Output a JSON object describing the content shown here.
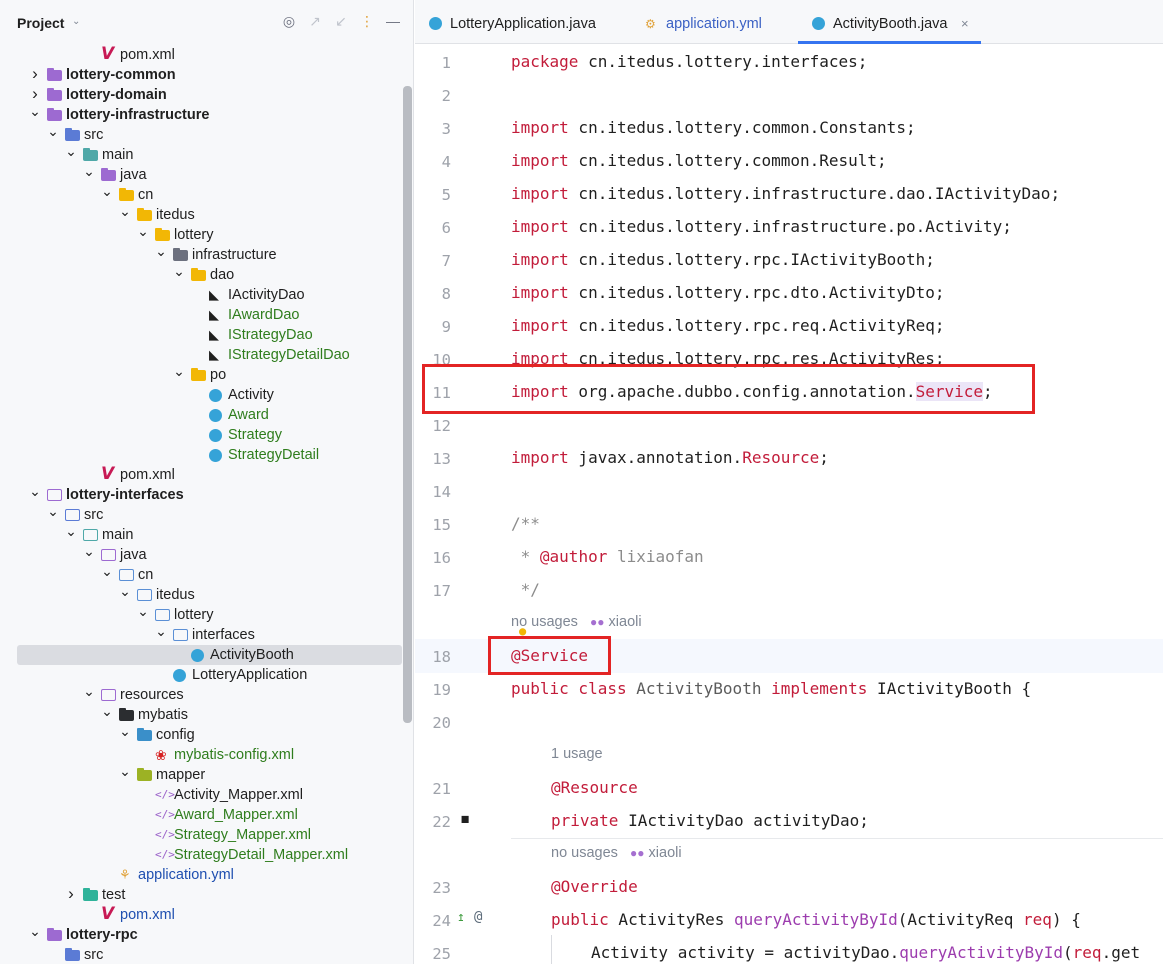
{
  "project_panel": {
    "title": "Project",
    "tree": [
      {
        "indent": 4,
        "label": "pom.xml",
        "icon": "maven-icon",
        "arrow": "",
        "style": ""
      },
      {
        "indent": 1,
        "label": "lottery-common",
        "icon": "module-folder-icon",
        "arrow": "right",
        "style": "bold"
      },
      {
        "indent": 1,
        "label": "lottery-domain",
        "icon": "module-folder-icon",
        "arrow": "right",
        "style": "bold"
      },
      {
        "indent": 1,
        "label": "lottery-infrastructure",
        "icon": "module-folder-icon",
        "arrow": "down",
        "style": "bold"
      },
      {
        "indent": 2,
        "label": "src",
        "icon": "src-folder-icon",
        "arrow": "down",
        "style": ""
      },
      {
        "indent": 3,
        "label": "main",
        "icon": "main-folder-icon",
        "arrow": "down",
        "style": ""
      },
      {
        "indent": 4,
        "label": "java",
        "icon": "java-folder-icon",
        "arrow": "down",
        "style": ""
      },
      {
        "indent": 5,
        "label": "cn",
        "icon": "package-folder-icon",
        "arrow": "down",
        "style": ""
      },
      {
        "indent": 6,
        "label": "itedus",
        "icon": "package-folder-icon",
        "arrow": "down",
        "style": ""
      },
      {
        "indent": 7,
        "label": "lottery",
        "icon": "package-folder-icon",
        "arrow": "down",
        "style": ""
      },
      {
        "indent": 8,
        "label": "infrastructure",
        "icon": "gray-package-icon",
        "arrow": "down",
        "style": ""
      },
      {
        "indent": 9,
        "label": "dao",
        "icon": "package-folder-icon",
        "arrow": "down",
        "style": ""
      },
      {
        "indent": 10,
        "label": "IActivityDao",
        "icon": "mybatis-bird-icon",
        "arrow": "",
        "style": ""
      },
      {
        "indent": 10,
        "label": "IAwardDao",
        "icon": "mybatis-bird-icon",
        "arrow": "",
        "style": "green"
      },
      {
        "indent": 10,
        "label": "IStrategyDao",
        "icon": "mybatis-bird-icon",
        "arrow": "",
        "style": "green"
      },
      {
        "indent": 10,
        "label": "IStrategyDetailDao",
        "icon": "mybatis-bird-icon",
        "arrow": "",
        "style": "green"
      },
      {
        "indent": 9,
        "label": "po",
        "icon": "package-folder-icon",
        "arrow": "down",
        "style": ""
      },
      {
        "indent": 10,
        "label": "Activity",
        "icon": "class-icon",
        "arrow": "",
        "style": ""
      },
      {
        "indent": 10,
        "label": "Award",
        "icon": "class-icon",
        "arrow": "",
        "style": "green"
      },
      {
        "indent": 10,
        "label": "Strategy",
        "icon": "class-icon",
        "arrow": "",
        "style": "green"
      },
      {
        "indent": 10,
        "label": "StrategyDetail",
        "icon": "class-icon",
        "arrow": "",
        "style": "green"
      },
      {
        "indent": 4,
        "label": "pom.xml",
        "icon": "maven-icon",
        "arrow": "",
        "style": ""
      },
      {
        "indent": 1,
        "label": "lottery-interfaces",
        "icon": "module-outline-icon",
        "arrow": "down",
        "style": "bold"
      },
      {
        "indent": 2,
        "label": "src",
        "icon": "src-outline-icon",
        "arrow": "down",
        "style": ""
      },
      {
        "indent": 3,
        "label": "main",
        "icon": "main-outline-icon",
        "arrow": "down",
        "style": ""
      },
      {
        "indent": 4,
        "label": "java",
        "icon": "java-outline-icon",
        "arrow": "down",
        "style": ""
      },
      {
        "indent": 5,
        "label": "cn",
        "icon": "package-outline-icon",
        "arrow": "down",
        "style": ""
      },
      {
        "indent": 6,
        "label": "itedus",
        "icon": "package-outline-icon",
        "arrow": "down",
        "style": ""
      },
      {
        "indent": 7,
        "label": "lottery",
        "icon": "package-outline-icon",
        "arrow": "down",
        "style": ""
      },
      {
        "indent": 8,
        "label": "interfaces",
        "icon": "package-outline-icon",
        "arrow": "down",
        "style": ""
      },
      {
        "indent": 9,
        "label": "ActivityBooth",
        "icon": "class-icon",
        "arrow": "",
        "style": "selected"
      },
      {
        "indent": 8,
        "label": "LotteryApplication",
        "icon": "class-icon",
        "arrow": "",
        "style": ""
      },
      {
        "indent": 4,
        "label": "resources",
        "icon": "resources-outline-icon",
        "arrow": "down",
        "style": ""
      },
      {
        "indent": 5,
        "label": "mybatis",
        "icon": "dark-folder-icon",
        "arrow": "down",
        "style": ""
      },
      {
        "indent": 6,
        "label": "config",
        "icon": "config-folder-icon",
        "arrow": "down",
        "style": ""
      },
      {
        "indent": 7,
        "label": "mybatis-config.xml",
        "icon": "mybatis-icon",
        "arrow": "",
        "style": "green"
      },
      {
        "indent": 6,
        "label": "mapper",
        "icon": "mapper-folder-icon",
        "arrow": "down",
        "style": ""
      },
      {
        "indent": 7,
        "label": "Activity_Mapper.xml",
        "icon": "xml-icon",
        "arrow": "",
        "style": ""
      },
      {
        "indent": 7,
        "label": "Award_Mapper.xml",
        "icon": "xml-icon",
        "arrow": "",
        "style": "green"
      },
      {
        "indent": 7,
        "label": "Strategy_Mapper.xml",
        "icon": "xml-icon",
        "arrow": "",
        "style": "green"
      },
      {
        "indent": 7,
        "label": "StrategyDetail_Mapper.xml",
        "icon": "xml-icon",
        "arrow": "",
        "style": "green"
      },
      {
        "indent": 5,
        "label": "application.yml",
        "icon": "yaml-icon",
        "arrow": "",
        "style": "blue"
      },
      {
        "indent": 3,
        "label": "test",
        "icon": "test-folder-icon",
        "arrow": "right",
        "style": ""
      },
      {
        "indent": 4,
        "label": "pom.xml",
        "icon": "maven-icon",
        "arrow": "",
        "style": "blue"
      },
      {
        "indent": 1,
        "label": "lottery-rpc",
        "icon": "module-folder-icon",
        "arrow": "down",
        "style": "bold"
      },
      {
        "indent": 2,
        "label": "src",
        "icon": "src-folder-icon",
        "arrow": "",
        "style": ""
      }
    ]
  },
  "tabs": [
    {
      "label": "LotteryApplication.java",
      "icon": "class-icon",
      "active": false
    },
    {
      "label": "application.yml",
      "icon": "yaml-icon",
      "active": false
    },
    {
      "label": "ActivityBooth.java",
      "icon": "class-icon",
      "active": true
    }
  ],
  "tab_close_glyph": "×",
  "editor": {
    "line_numbers": [
      "1",
      "2",
      "3",
      "4",
      "5",
      "6",
      "7",
      "8",
      "9",
      "10",
      "11",
      "12",
      "13",
      "14",
      "15",
      "16",
      "17",
      "18",
      "19",
      "20",
      "21",
      "22",
      "23",
      "24",
      "25"
    ],
    "code": {
      "l1_kw": "package",
      "l1": " cn.itedus.lottery.interfaces;",
      "l3": " cn.itedus.lottery.common.Constants;",
      "l4": " cn.itedus.lottery.common.Result;",
      "l5": " cn.itedus.lottery.infrastructure.dao.IActivityDao;",
      "l6": " cn.itedus.lottery.infrastructure.po.Activity;",
      "l7": " cn.itedus.lottery.rpc.IActivityBooth;",
      "l8": " cn.itedus.lottery.rpc.dto.ActivityDto;",
      "l9": " cn.itedus.lottery.rpc.req.ActivityReq;",
      "l10": " cn.itedus.lottery.rpc.res.ActivityRes;",
      "l11_pre": " org.apache.dubbo.config.annotation.",
      "l11_hl": "Service",
      "l11_post": ";",
      "l13_pre": " javax.annotation.",
      "l13_res": "Resource",
      "l13_post": ";",
      "import_kw": "import",
      "l15": "/**",
      "l16_pre": " * ",
      "l16_tag": "@author",
      "l16_post": " lixiaofan",
      "l17": " */",
      "l18": "@Service",
      "l19_kw1": "public class",
      "l19_cls": " ActivityBooth",
      "l19_kw2": " implements",
      "l19_post": " IActivityBooth {",
      "l21": "@Resource",
      "l22_kw": "private",
      "l22_post": " IActivityDao activityDao;",
      "l23": "@Override",
      "l24_kw": "public",
      "l24_type": " ActivityRes ",
      "l24_m": "queryActivityById",
      "l24_a": "(ActivityReq ",
      "l24_p": "req",
      "l24_b": ") {",
      "l25_pre": "Activity activity = activityDao.",
      "l25_m": "queryActivityById",
      "l25_a": "(",
      "l25_p": "req",
      "l25_post": ".get"
    },
    "hints": {
      "h1_usages": "no usages",
      "h1_user": "xiaoli",
      "h2_usages": "1 usage",
      "h3_usages": "no usages",
      "h3_user": "xiaoli"
    }
  },
  "colors": {
    "accent": "#3574f0",
    "highlight_box": "#e32424",
    "keyword": "#c21c3a"
  }
}
